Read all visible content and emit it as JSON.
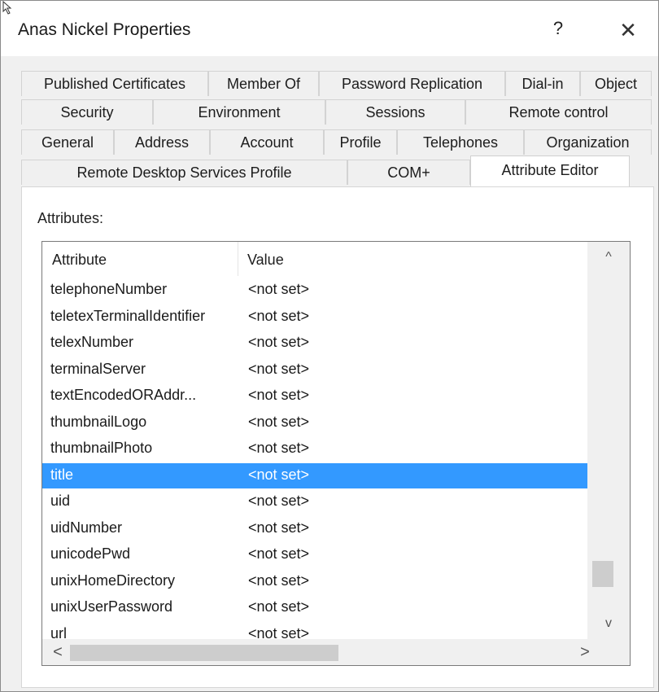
{
  "window": {
    "title": "Anas Nickel Properties",
    "help_label": "?",
    "close_label": "✕"
  },
  "tabs": {
    "row1": [
      "Published Certificates",
      "Member Of",
      "Password Replication",
      "Dial-in",
      "Object"
    ],
    "row2": [
      "Security",
      "Environment",
      "Sessions",
      "Remote control"
    ],
    "row3": [
      "General",
      "Address",
      "Account",
      "Profile",
      "Telephones",
      "Organization"
    ],
    "row4": [
      "Remote Desktop Services Profile",
      "COM+",
      "Attribute Editor"
    ],
    "active": "Attribute Editor"
  },
  "panel": {
    "attributes_label": "Attributes:",
    "columns": [
      "Attribute",
      "Value"
    ],
    "rows": [
      {
        "attribute": "telephoneNumber",
        "value": "<not set>"
      },
      {
        "attribute": "teletexTerminalIdentifier",
        "value": "<not set>"
      },
      {
        "attribute": "telexNumber",
        "value": "<not set>"
      },
      {
        "attribute": "terminalServer",
        "value": "<not set>"
      },
      {
        "attribute": "textEncodedORAddr...",
        "value": "<not set>"
      },
      {
        "attribute": "thumbnailLogo",
        "value": "<not set>"
      },
      {
        "attribute": "thumbnailPhoto",
        "value": "<not set>"
      },
      {
        "attribute": "title",
        "value": "<not set>"
      },
      {
        "attribute": "uid",
        "value": "<not set>"
      },
      {
        "attribute": "uidNumber",
        "value": "<not set>"
      },
      {
        "attribute": "unicodePwd",
        "value": "<not set>"
      },
      {
        "attribute": "unixHomeDirectory",
        "value": "<not set>"
      },
      {
        "attribute": "unixUserPassword",
        "value": "<not set>"
      },
      {
        "attribute": "url",
        "value": "<not set>"
      }
    ],
    "selected_attribute": "title",
    "scroll": {
      "up": "^",
      "down": "v",
      "left": "<",
      "right": ">"
    }
  },
  "colors": {
    "selection": "#3399ff",
    "dialog_bg": "#f0f0f0",
    "scroll_thumb": "#cdcdcd"
  }
}
